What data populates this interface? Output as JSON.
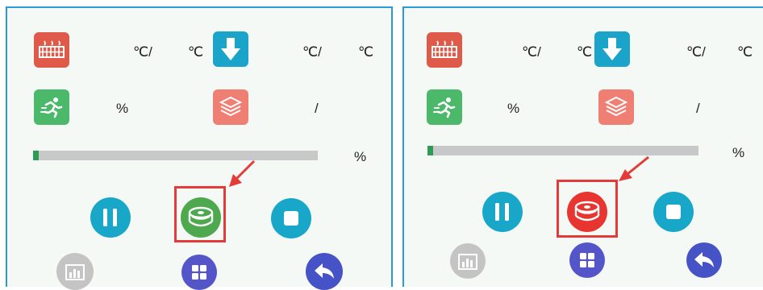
{
  "colors": {
    "frame_border": "#2b9ad8",
    "panel_bg": "#f5f9f6",
    "hotbed": "#e05a4a",
    "fan": "#4cb86a",
    "extruder": "#1ba4c9",
    "layers": "#f07f73",
    "progress_fill": "#2f9c55",
    "progress_track": "#c8c8c8",
    "pause": "#19a7c9",
    "stop": "#19a7c9",
    "filament_normal": "#4ea84d",
    "filament_alert": "#e8352f",
    "stats": "#c4c4c4",
    "menu": "#5355c9",
    "back": "#4653c7",
    "highlight": "#e33a3a"
  },
  "icons": {
    "hotbed": "hotbed-heater-icon",
    "extruder": "extruder-down-arrow-icon",
    "fan": "running-figure-speed-icon",
    "layers": "layers-stack-icon",
    "pause": "pause-icon",
    "filament": "filament-spool-icon",
    "stop": "stop-icon",
    "stats": "bar-chart-icon",
    "menu": "grid-menu-icon",
    "back": "back-arrow-icon"
  },
  "status": {
    "bed_temp_unit": "℃/",
    "bed_target_unit": "℃",
    "extruder_temp_unit": "℃/",
    "extruder_target_unit": "℃",
    "speed_unit": "%",
    "layer_separator": "/",
    "progress_unit": "%",
    "progress_fraction": 0.02
  }
}
